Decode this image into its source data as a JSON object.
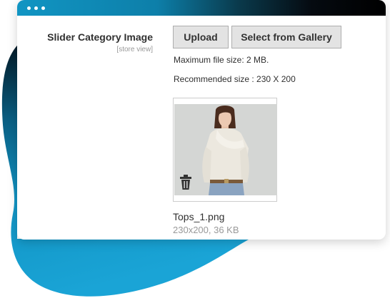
{
  "window": {
    "controls": [
      "close",
      "minimize",
      "maximize"
    ]
  },
  "field": {
    "label": "Slider Category Image",
    "scope": "[store view]"
  },
  "buttons": {
    "upload_label": "Upload",
    "gallery_label": "Select from Gallery"
  },
  "notes": {
    "max_size": "Maximum file size: 2 MB.",
    "recommended": "Recommended size : 230 X 200"
  },
  "image": {
    "file_name": "Tops_1.png",
    "file_meta": "230x200, 36 KB",
    "delete_icon": "trash-icon"
  },
  "colors": {
    "accent": "#1195c3",
    "dark": "#000000",
    "button_bg": "#e3e3e3"
  }
}
